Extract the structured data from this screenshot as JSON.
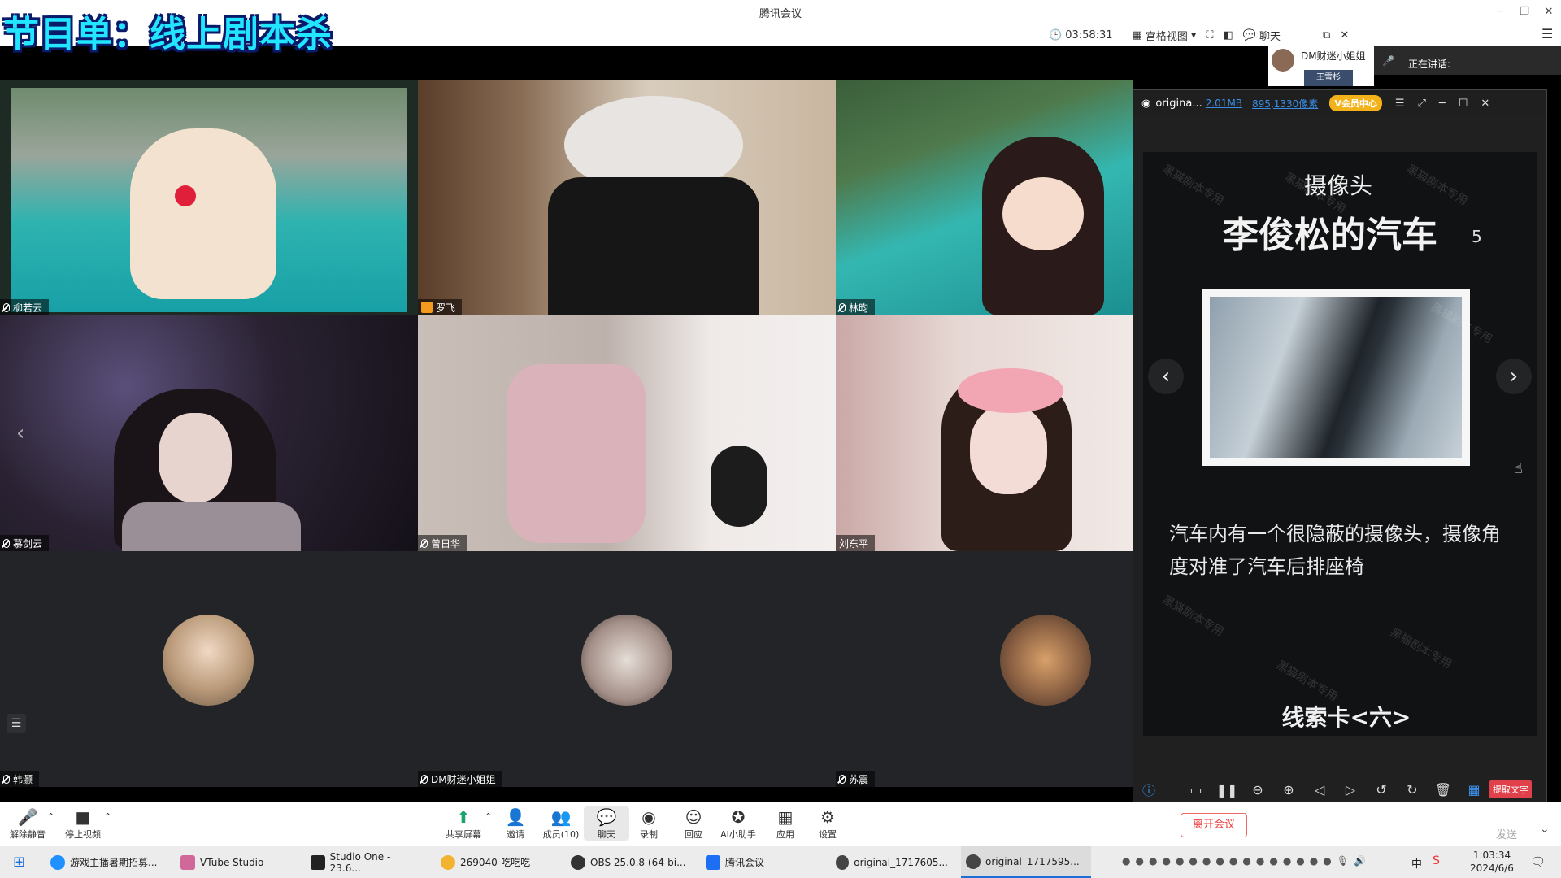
{
  "window": {
    "title": "腾讯会议",
    "overlay_title": "节目单：线上剧本杀"
  },
  "top_toolbar": {
    "timer": "03:58:31",
    "view_label": "宫格视图",
    "chat_label": "聊天"
  },
  "speaker": {
    "thumb_name": "DM财迷小姐姐",
    "thumb_sub": "王雪杉",
    "speaking_label": "正在讲话:"
  },
  "participants": [
    {
      "name": "柳若云"
    },
    {
      "name": "罗飞"
    },
    {
      "name": "林昀"
    },
    {
      "name": "慕剑云"
    },
    {
      "name": "曾日华"
    },
    {
      "name": "刘东平"
    },
    {
      "name": "韩灏"
    },
    {
      "name": "DM财迷小姐姐"
    },
    {
      "name": "苏震"
    }
  ],
  "viewer": {
    "file_name": "origina...",
    "file_size": "2.01MB",
    "dimensions": "895,1330像素",
    "vip_label": "V会员中心",
    "card_heading": "摄像头",
    "card_title": "李俊松的汽车",
    "card_number": "5",
    "card_text": "汽车内有一个很隐蔽的摄像头，摄像角度对准了汽车后排座椅",
    "card_footer": "线索卡<六>",
    "watermark": "黑猫剧本专用",
    "extract_button": "提取文字"
  },
  "bottom_toolbar": {
    "unmute": "解除静音",
    "stop_video": "停止视频",
    "share_screen": "共享屏幕",
    "invite": "邀请",
    "members": "成员(10)",
    "chat": "聊天",
    "record": "录制",
    "reactions": "回应",
    "ai_assistant": "AI小助手",
    "apps": "应用",
    "settings": "设置",
    "leave": "离开会议",
    "send": "发送"
  },
  "taskbar": {
    "items": [
      "游戏主播暑期招募...",
      "VTube Studio",
      "Studio One - 23.6...",
      "269040-吃吃吃",
      "OBS 25.0.8 (64-bi...",
      "腾讯会议",
      "original_1717605...",
      "original_1717595..."
    ],
    "time": "1:03:34",
    "date": "2024/6/6",
    "ime": "中"
  }
}
